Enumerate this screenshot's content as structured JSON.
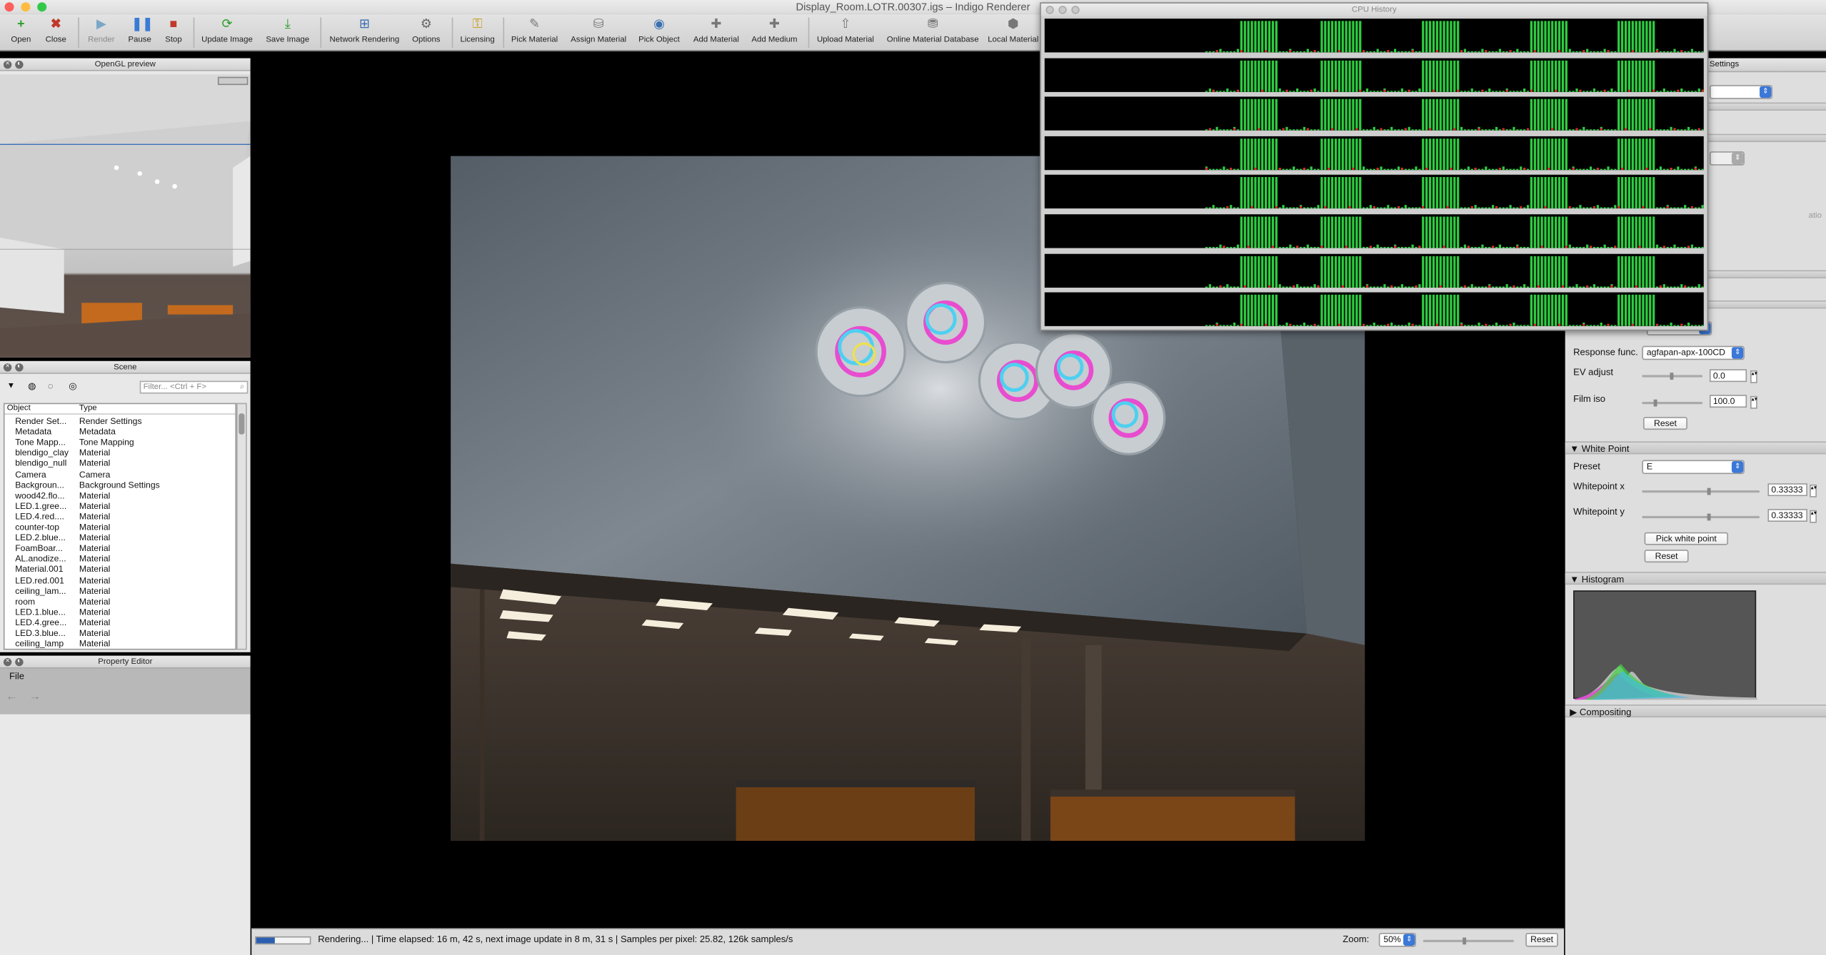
{
  "window": {
    "title": "Display_Room.LOTR.00307.igs – Indigo Renderer"
  },
  "toolbar": [
    {
      "label": "Open",
      "icon": "plus-icon",
      "enabled": true
    },
    {
      "label": "Close",
      "icon": "close-x-icon",
      "enabled": true
    },
    {
      "label": "Render",
      "icon": "play-icon",
      "enabled": false
    },
    {
      "label": "Pause",
      "icon": "pause-icon",
      "enabled": true
    },
    {
      "label": "Stop",
      "icon": "stop-icon",
      "enabled": true
    },
    {
      "label": "Update Image",
      "icon": "refresh-icon",
      "enabled": true
    },
    {
      "label": "Save Image",
      "icon": "save-icon",
      "enabled": true
    },
    {
      "label": "Network Rendering",
      "icon": "network-icon",
      "enabled": true
    },
    {
      "label": "Options",
      "icon": "gear-icon",
      "enabled": true
    },
    {
      "label": "Licensing",
      "icon": "key-icon",
      "enabled": true
    },
    {
      "label": "Pick Material",
      "icon": "eyedropper-icon",
      "enabled": true
    },
    {
      "label": "Assign Material",
      "icon": "bucket-icon",
      "enabled": true
    },
    {
      "label": "Pick Object",
      "icon": "eye-icon",
      "enabled": true
    },
    {
      "label": "Add Material",
      "icon": "add-material-icon",
      "enabled": true
    },
    {
      "label": "Add Medium",
      "icon": "add-medium-icon",
      "enabled": true
    },
    {
      "label": "Upload Material",
      "icon": "upload-icon",
      "enabled": true
    },
    {
      "label": "Online Material Database",
      "icon": "database-icon",
      "enabled": true
    },
    {
      "label": "Local Material",
      "icon": "local-material-icon",
      "enabled": true
    }
  ],
  "gl_preview": {
    "title": "OpenGL preview"
  },
  "scene": {
    "title": "Scene",
    "filter_placeholder": "Filter... <Ctrl + F>",
    "columns": [
      "Object",
      "Type"
    ],
    "rows": [
      [
        "Render Set...",
        "Render Settings"
      ],
      [
        "Metadata",
        "Metadata"
      ],
      [
        "Tone Mapp...",
        "Tone Mapping"
      ],
      [
        "blendigo_clay",
        "Material"
      ],
      [
        "blendigo_null",
        "Material"
      ],
      [
        "Camera",
        "Camera"
      ],
      [
        "Backgroun...",
        "Background Settings"
      ],
      [
        "wood42.flo...",
        "Material"
      ],
      [
        "LED.1.gree...",
        "Material"
      ],
      [
        "LED.4.red....",
        "Material"
      ],
      [
        "counter-top",
        "Material"
      ],
      [
        "LED.2.blue...",
        "Material"
      ],
      [
        "FoamBoar...",
        "Material"
      ],
      [
        "AL.anodize...",
        "Material"
      ],
      [
        "Material.001",
        "Material"
      ],
      [
        "LED.red.001",
        "Material"
      ],
      [
        "ceiling_lam...",
        "Material"
      ],
      [
        "room",
        "Material"
      ],
      [
        "LED.1.blue...",
        "Material"
      ],
      [
        "LED.4.gree...",
        "Material"
      ],
      [
        "LED.3.blue...",
        "Material"
      ],
      [
        "ceiling_lamp",
        "Material"
      ]
    ]
  },
  "property_editor": {
    "title": "Property Editor",
    "menu": "File"
  },
  "status": {
    "text": "Rendering... | Time elapsed: 16 m, 42 s, next image update in 8 m, 31 s | Samples per pixel: 25.82, 126k samples/s",
    "progress": 0.35,
    "zoom_label": "Zoom:",
    "zoom_value": "50%",
    "reset_label": "Reset"
  },
  "right_panel": {
    "settings_tab": "Settings",
    "response_func_label": "Response func.",
    "response_func_value": "agfapan-apx-100CD",
    "ev_adjust_label": "EV adjust",
    "ev_adjust_value": "0.0",
    "film_iso_label": "Film iso",
    "film_iso_value": "100.0",
    "reset_label": "Reset",
    "white_point_header": "White Point",
    "preset_label": "Preset",
    "preset_value": "E",
    "whitepoint_x_label": "Whitepoint x",
    "whitepoint_x_value": "0.33333",
    "whitepoint_y_label": "Whitepoint y",
    "whitepoint_y_value": "0.33333",
    "pick_white_point_label": "Pick white point",
    "reset2_label": "Reset",
    "histogram_header": "Histogram",
    "compositing_header": "Compositing",
    "partial_text": "atio"
  },
  "cpu_history": {
    "title": "CPU History",
    "cores": 8
  }
}
